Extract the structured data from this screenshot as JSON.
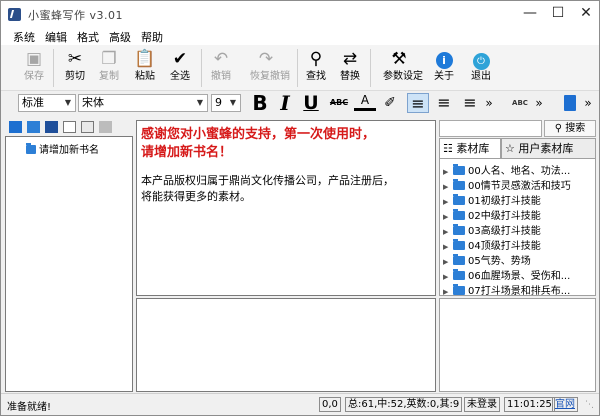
{
  "window": {
    "title": "小蜜蜂写作 v3.01"
  },
  "menubar": {
    "items": [
      "系统",
      "编辑",
      "格式",
      "高级",
      "帮助"
    ]
  },
  "toolbar": {
    "save": "保存",
    "cut": "剪切",
    "copy": "复制",
    "paste": "粘贴",
    "select_all": "全选",
    "undo": "撤销",
    "redo": "恢复撤销",
    "find": "查找",
    "replace": "替换",
    "settings": "参数设定",
    "about": "关于",
    "exit": "退出"
  },
  "format": {
    "style": "标准",
    "font": "宋体",
    "size": "9",
    "bold": "B",
    "italic": "I",
    "underline": "U",
    "strike": "ABC",
    "font_color_letter": "A",
    "more1": "»",
    "more2": "»",
    "more3": "»",
    "spell": "ABC"
  },
  "book_tree": {
    "item": "请增加新书名"
  },
  "editor": {
    "welcome_line1": "感谢您对小蜜蜂的支持，第一次使用时，",
    "welcome_line2": "请增加新书名！",
    "body_line1": "本产品版权归属于鼎尚文化传播公司，产品注册后，",
    "body_line2": "将能获得更多的素材。"
  },
  "search": {
    "button": "搜索",
    "value": ""
  },
  "material": {
    "tab_library": "素材库",
    "tab_user": "用户素材库",
    "items": [
      "00人名、地名、功法...",
      "00情节灵感激活和技巧",
      "01初级打斗技能",
      "02中级打斗技能",
      "03高级打斗技能",
      "04顶级打斗技能",
      "05气势、势场",
      "06血腥场景、受伤和...",
      "07打斗场景和排兵布..."
    ]
  },
  "status": {
    "message": "准备就绪!",
    "cursor": "0,0",
    "counts": "总:61,中:52,英数:0,其:9",
    "login": "未登录",
    "time": "11:01:25",
    "site": "官网"
  }
}
